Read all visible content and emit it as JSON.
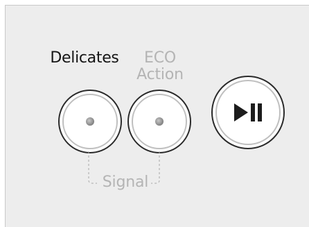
{
  "labels": {
    "delicates": "Delicates",
    "eco_line1": "ECO",
    "eco_line2": "Action",
    "signal": "Signal"
  },
  "icons": {
    "start": "play-pause-icon",
    "indicator": "indicator-led"
  },
  "colors": {
    "panel": "#ededed",
    "active_text": "#151515",
    "inactive_text": "#b4b4b4",
    "button_outline": "#2a2a2a",
    "led": "#8a8a8a"
  }
}
